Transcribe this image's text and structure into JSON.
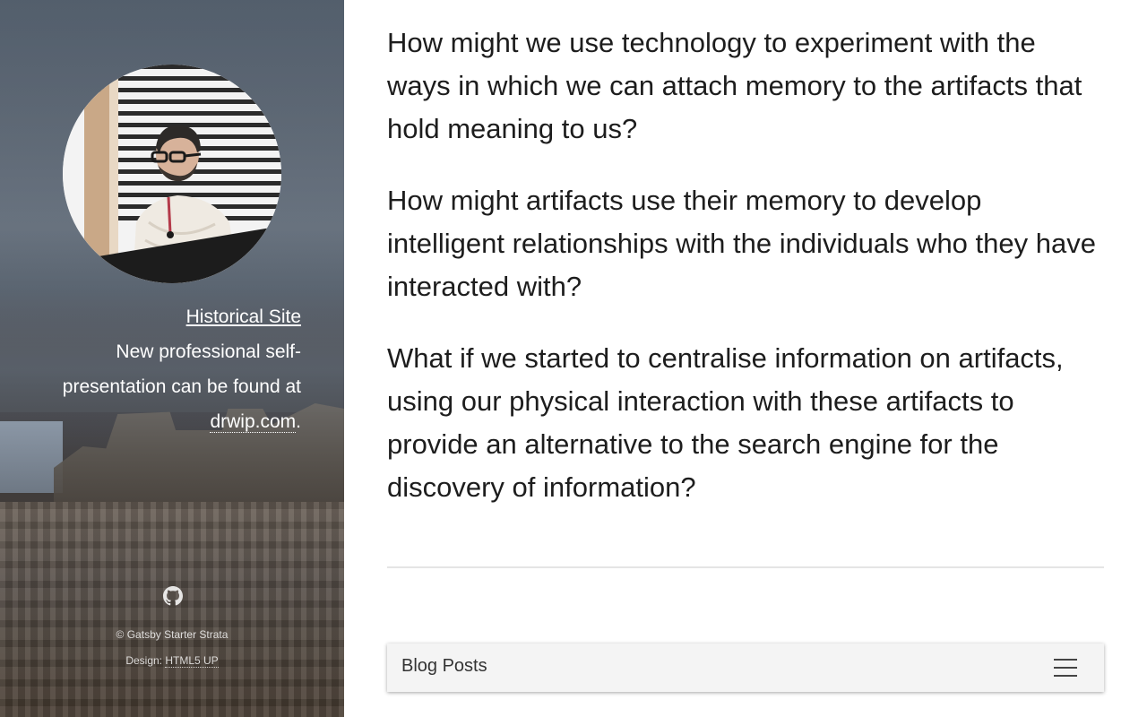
{
  "sidebar": {
    "avatar_alt": "avatar",
    "historical_link": "Historical Site",
    "intro_text": "New professional self-presentation can be found at",
    "drwip_link": "drwip.com",
    "drwip_after": ".",
    "github_icon": "github-icon",
    "footer": {
      "copyright": "© Gatsby Starter Strata",
      "design_prefix": "Design:",
      "design_link": "HTML5 UP"
    }
  },
  "main": {
    "paragraphs": [
      "How might we use technology to experiment with the ways in which we can attach memory to the artifacts that hold meaning to us?",
      "How might artifacts use their memory to develop intelligent relationships with the individuals who they have interacted with?",
      "What if we started to centralise information on artifacts, using our physical interaction with these artifacts to provide an alternative to the search engine for the discovery of information?"
    ]
  },
  "blog_bar": {
    "label": "Blog Posts",
    "menu_icon": "hamburger-menu-icon"
  },
  "colors": {
    "text": "#1d1d1d",
    "divider": "#e5e5e5",
    "bar_bg": "#f4f4f4"
  }
}
